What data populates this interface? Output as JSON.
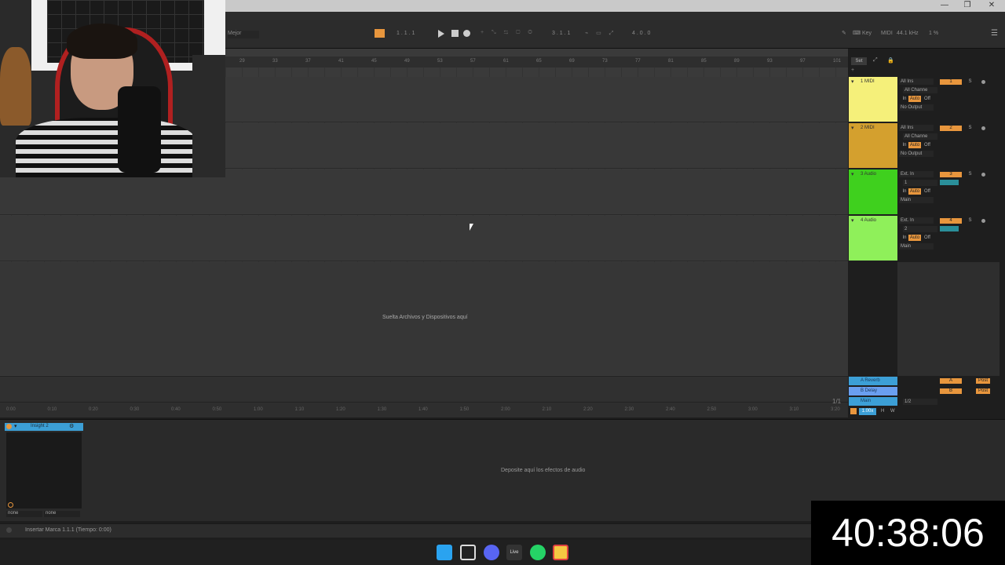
{
  "app": {
    "window_controls": [
      "—",
      "❐",
      "✕"
    ]
  },
  "controlbar": {
    "scale": "Mejor",
    "position": "1 . 1 . 1",
    "loop_start": "3 . 1 . 1",
    "loop_length": "4 . 0 . 0",
    "key_label": "Key",
    "midi_label": "MIDI",
    "sample_rate": "44.1 kHz",
    "cpu": "1 %"
  },
  "ruler": {
    "bars": [
      "29",
      "33",
      "37",
      "41",
      "45",
      "49",
      "53",
      "57",
      "61",
      "65",
      "69",
      "73",
      "77",
      "81",
      "85",
      "89",
      "93",
      "97",
      "101"
    ],
    "set_label": "Set"
  },
  "timeline": {
    "times": [
      "0:00",
      "0:10",
      "0:20",
      "0:30",
      "0:40",
      "0:50",
      "1:00",
      "1:10",
      "1:20",
      "1:30",
      "1:40",
      "1:50",
      "2:00",
      "2:10",
      "2:20",
      "2:30",
      "2:40",
      "2:50",
      "3:00",
      "3:10",
      "3:20"
    ],
    "page": "1/1",
    "zoom": "1.00x",
    "h_label": "H",
    "w_label": "W"
  },
  "arrangement": {
    "drop_hint": "Suelta Archivos y Dispositivos aquí"
  },
  "tracks": [
    {
      "name": "1 MIDI",
      "color": "#f5f07a",
      "input": "All Ins",
      "channel": "All Channe",
      "monitor": [
        "In",
        "Auto",
        "Off"
      ],
      "output": "No Output",
      "number": "1"
    },
    {
      "name": "2 MIDI",
      "color": "#d4a02e",
      "input": "All Ins",
      "channel": "All Channe",
      "monitor": [
        "In",
        "Auto",
        "Off"
      ],
      "output": "No Output",
      "number": "2"
    },
    {
      "name": "3 Audio",
      "color": "#3fd01e",
      "input": "Ext. In",
      "channel": "1",
      "monitor": [
        "In",
        "Auto",
        "Off"
      ],
      "output": "Main",
      "number": "3"
    },
    {
      "name": "4 Audio",
      "color": "#8ff05a",
      "input": "Ext. In",
      "channel": "2",
      "monitor": [
        "In",
        "Auto",
        "Off"
      ],
      "output": "Main",
      "number": "4"
    }
  ],
  "returns": [
    {
      "name": "A Reverb",
      "letter": "A",
      "post": "Post"
    },
    {
      "name": "B Delay",
      "letter": "B",
      "post": "Post"
    },
    {
      "name": "Main",
      "letter": "",
      "post": "",
      "channel": "1/2"
    }
  ],
  "device": {
    "name": "Insight 2",
    "sel1": "none",
    "sel2": "none",
    "drop_hint": "Deposite aquí los efectos de audio"
  },
  "status": {
    "message": "Insertar Marca 1.1.1 (Tiempo: 0:00)"
  },
  "taskbar": {
    "live_label": "Live"
  },
  "overlay": {
    "timer": "40:38:06"
  }
}
